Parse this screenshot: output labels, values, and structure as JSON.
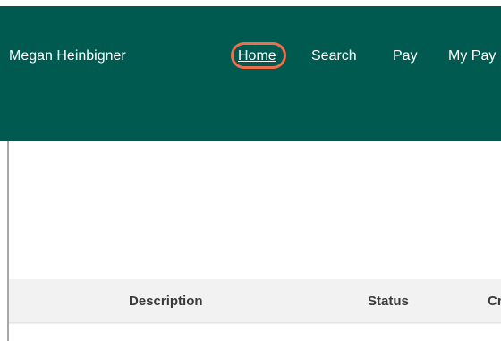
{
  "header": {
    "user_name": "Megan Heinbigner",
    "nav": [
      {
        "label": "Home"
      },
      {
        "label": "Search"
      },
      {
        "label": "Pay"
      },
      {
        "label": "My Pay"
      }
    ]
  },
  "table": {
    "columns": [
      "Description",
      "Status",
      "Cr"
    ]
  },
  "colors": {
    "header_bg": "#005a4f",
    "highlight": "#f06e4a",
    "table_header_bg": "#f2f2f2"
  }
}
